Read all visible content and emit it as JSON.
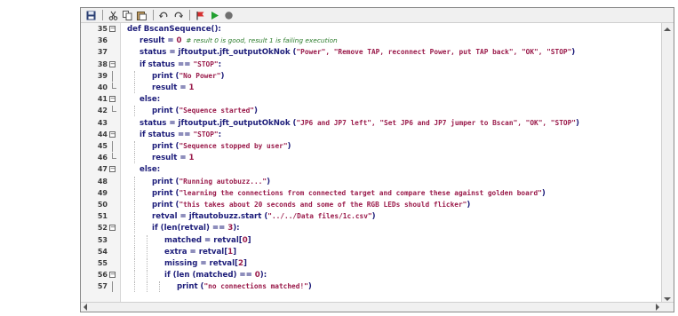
{
  "toolbar": {
    "icons": [
      "save-icon",
      "cut-icon",
      "copy-icon",
      "paste-icon",
      "undo-icon",
      "redo-icon",
      "breakpoint-icon",
      "run-icon",
      "stop-icon"
    ]
  },
  "lines": [
    {
      "n": "35",
      "segs": [
        [
          "kw",
          "def BscanSequence():"
        ]
      ]
    },
    {
      "n": "36",
      "segs": [
        [
          "kw",
          "result = "
        ],
        [
          "num",
          "0"
        ],
        [
          "cmt",
          "  # result 0 is good, result 1 is failing execution"
        ]
      ]
    },
    {
      "n": "37",
      "segs": [
        [
          "kw",
          "status = jftoutput.jft_outputOkNok ("
        ],
        [
          "str",
          "\"Power\", \"Remove TAP, reconnect Power, put TAP back\", \"OK\", \"STOP\""
        ],
        [
          "kw",
          ")"
        ]
      ]
    },
    {
      "n": "38",
      "segs": [
        [
          "kw",
          "if status == "
        ],
        [
          "str",
          "\"STOP\""
        ],
        [
          "kw",
          ":"
        ]
      ]
    },
    {
      "n": "39",
      "segs": [
        [
          "kw",
          "print ("
        ],
        [
          "str",
          "\"No Power\""
        ],
        [
          "kw",
          ")"
        ]
      ]
    },
    {
      "n": "40",
      "segs": [
        [
          "kw",
          "result = "
        ],
        [
          "num",
          "1"
        ]
      ]
    },
    {
      "n": "41",
      "segs": [
        [
          "kw",
          "else:"
        ]
      ]
    },
    {
      "n": "42",
      "segs": [
        [
          "kw",
          "print ("
        ],
        [
          "str",
          "\"Sequence started\""
        ],
        [
          "kw",
          ")"
        ]
      ]
    },
    {
      "n": "43",
      "segs": [
        [
          "kw",
          "status = jftoutput.jft_outputOkNok ("
        ],
        [
          "str",
          "\"JP6 and JP7 left\", \"Set JP6 and JP7 jumper to Bscan\", \"OK\", \"STOP\""
        ],
        [
          "kw",
          ")"
        ]
      ]
    },
    {
      "n": "44",
      "segs": [
        [
          "kw",
          "if status == "
        ],
        [
          "str",
          "\"STOP\""
        ],
        [
          "kw",
          ":"
        ]
      ]
    },
    {
      "n": "45",
      "segs": [
        [
          "kw",
          "print ("
        ],
        [
          "str",
          "\"Sequence stopped by user\""
        ],
        [
          "kw",
          ")"
        ]
      ]
    },
    {
      "n": "46",
      "segs": [
        [
          "kw",
          "result = "
        ],
        [
          "num",
          "1"
        ]
      ]
    },
    {
      "n": "47",
      "segs": [
        [
          "kw",
          "else:"
        ]
      ]
    },
    {
      "n": "48",
      "segs": [
        [
          "kw",
          "print ("
        ],
        [
          "str",
          "\"Running autobuzz...\""
        ],
        [
          "kw",
          ")"
        ]
      ]
    },
    {
      "n": "49",
      "segs": [
        [
          "kw",
          "print ("
        ],
        [
          "str",
          "\"learning the connections from connected target and compare these against golden board\""
        ],
        [
          "kw",
          ")"
        ]
      ]
    },
    {
      "n": "50",
      "segs": [
        [
          "kw",
          "print ("
        ],
        [
          "str",
          "\"this takes about 20 seconds and some of the RGB LEDs should flicker\""
        ],
        [
          "kw",
          ")"
        ]
      ]
    },
    {
      "n": "51",
      "segs": [
        [
          "kw",
          "retval = jftautobuzz.start ("
        ],
        [
          "str",
          "\"../../Data files/1c.csv\""
        ],
        [
          "kw",
          ")"
        ]
      ]
    },
    {
      "n": "52",
      "segs": [
        [
          "kw",
          "if (len(retval) == "
        ],
        [
          "num",
          "3"
        ],
        [
          "kw",
          "):"
        ]
      ]
    },
    {
      "n": "53",
      "segs": [
        [
          "kw",
          "matched = retval["
        ],
        [
          "num",
          "0"
        ],
        [
          "kw",
          "]"
        ]
      ]
    },
    {
      "n": "54",
      "segs": [
        [
          "kw",
          "extra = retval["
        ],
        [
          "num",
          "1"
        ],
        [
          "kw",
          "]"
        ]
      ]
    },
    {
      "n": "55",
      "segs": [
        [
          "kw",
          "missing = retval["
        ],
        [
          "num",
          "2"
        ],
        [
          "kw",
          "]"
        ]
      ]
    },
    {
      "n": "56",
      "segs": [
        [
          "kw",
          "if (len (matched) == "
        ],
        [
          "num",
          "0"
        ],
        [
          "kw",
          "):"
        ]
      ]
    },
    {
      "n": "57",
      "segs": [
        [
          "kw",
          "print ("
        ],
        [
          "str",
          "\"no connections matched!\""
        ],
        [
          "kw",
          ")"
        ]
      ]
    }
  ]
}
